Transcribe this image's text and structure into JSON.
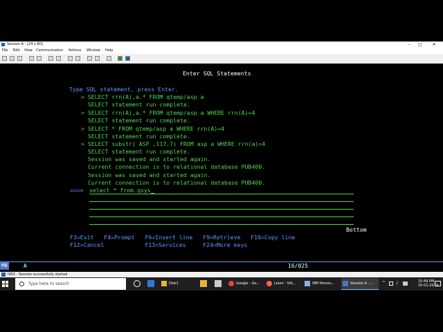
{
  "window": {
    "title": "Session A - [24 x 80]",
    "minimize": "–",
    "maximize": "□",
    "close": "✕"
  },
  "menu": [
    "File",
    "Edit",
    "View",
    "Communication",
    "Actions",
    "Window",
    "Help"
  ],
  "terminal": {
    "heading": "Enter SQL Statements",
    "instruction": "Type SQL statement, press Enter.",
    "history": [
      {
        "text": "> SELECT rrn(A),a.* FROM qtemp/asp a",
        "color": "green"
      },
      {
        "text": "  SELECT statement run complete.",
        "color": "green"
      },
      {
        "text": "> SELECT rrn(A),a.* FROM qtemp/asp a WHERE rrn(A)=4",
        "color": "green"
      },
      {
        "text": "  SELECT statement run complete.",
        "color": "green"
      },
      {
        "text": "> SELECT * FROM qtemp/asp a WHERE rrn(A)=4",
        "color": "green"
      },
      {
        "text": "  SELECT statement run complete.",
        "color": "green"
      },
      {
        "text": "> SELECT substr( ASP ,117,7) FROM asp a WHERE rrn(a)=4",
        "color": "green"
      },
      {
        "text": "  SELECT statement run complete.",
        "color": "green"
      },
      {
        "text": "  Session was saved and started again.",
        "color": "green"
      },
      {
        "text": "  Current connection is to relational database PUB400.",
        "color": "green"
      },
      {
        "text": "  Session was saved and started again.",
        "color": "green"
      },
      {
        "text": "  Current connection is to relational database PUB400.",
        "color": "green"
      }
    ],
    "prompt": "===>",
    "input_value": "select * from qsys",
    "bottom": "Bottom",
    "fkeys_row1": "F3=Exit   F4=Prompt   F6=Insert line   F9=Retrieve   F10=Copy line",
    "fkeys_row2": "F12=Cancel            F13=Services     F24=More keys"
  },
  "oia": {
    "mb": "MB",
    "mode": "A",
    "position": "16/025"
  },
  "status": {
    "message": "I902 - Session successfully started"
  },
  "taskbar": {
    "search_placeholder": "Type here to search",
    "apps": [
      {
        "label": "Disk1",
        "color": "#e8b339"
      },
      {
        "label": "Google - Go...",
        "color": "#e94335"
      },
      {
        "label": "Loom - Vid...",
        "color": "#ff623e"
      },
      {
        "label": "IBM Person...",
        "color": "#7fb3e8"
      },
      {
        "label": "Session A - ...",
        "color": "#4a78c9"
      }
    ],
    "clock_time": "10:49 PM",
    "clock_date": "25-01-2019"
  }
}
